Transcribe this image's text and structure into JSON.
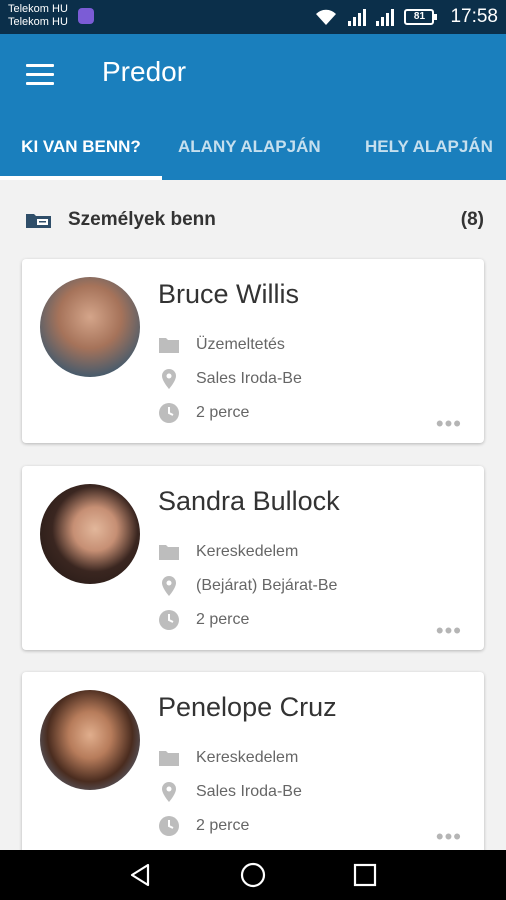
{
  "status_bar": {
    "carrier_1": "Telekom HU",
    "carrier_2": "Telekom HU",
    "battery": "81",
    "time": "17:58"
  },
  "app_bar": {
    "title": "Predor",
    "tabs": [
      "KI VAN BENN?",
      "ALANY ALAPJÁN",
      "HELY ALAPJÁN"
    ],
    "active_tab": 0
  },
  "section": {
    "title": "Személyek benn",
    "count": "(8)"
  },
  "people": [
    {
      "name": "Bruce Willis",
      "department": "Üzemeltetés",
      "location": "Sales Iroda-Be",
      "time": "2 perce"
    },
    {
      "name": "Sandra Bullock",
      "department": "Kereskedelem",
      "location": "(Bejárat) Bejárat-Be",
      "time": "2 perce"
    },
    {
      "name": "Penelope Cruz",
      "department": "Kereskedelem",
      "location": "Sales Iroda-Be",
      "time": "2 perce"
    }
  ],
  "colors": {
    "primary": "#1a7fbd",
    "status_bar": "#0b2f4a",
    "background": "#f2f2f2"
  },
  "icons": [
    "menu-icon",
    "folder-icon",
    "location-pin-icon",
    "clock-icon",
    "more-dots-icon",
    "back-icon",
    "home-icon",
    "recents-icon"
  ]
}
